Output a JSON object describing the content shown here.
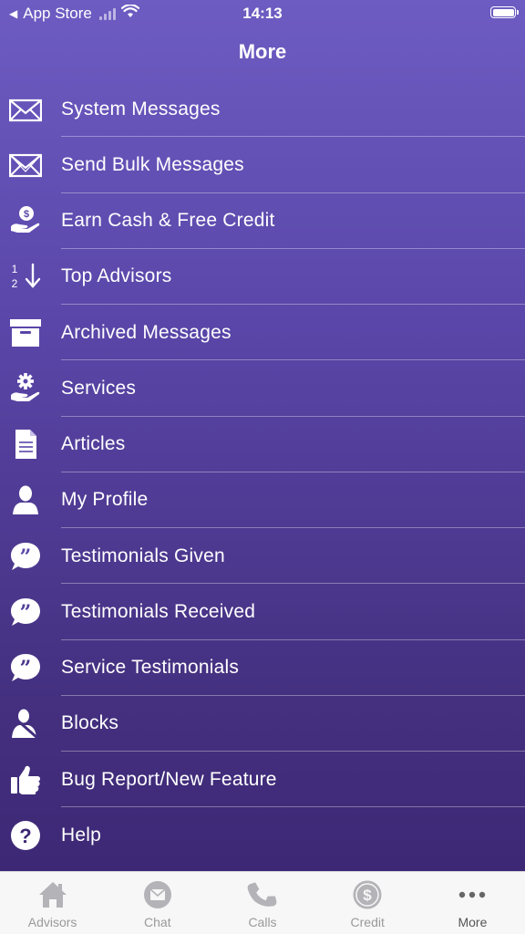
{
  "status_bar": {
    "back_label": "App Store",
    "time": "14:13"
  },
  "nav": {
    "title": "More"
  },
  "menu": {
    "items": [
      {
        "label": "System Messages",
        "icon": "envelope-icon"
      },
      {
        "label": "Send Bulk Messages",
        "icon": "bulk-envelope-icon"
      },
      {
        "label": "Earn Cash & Free Credit",
        "icon": "hand-money-icon"
      },
      {
        "label": "Top Advisors",
        "icon": "sort-numeric-icon"
      },
      {
        "label": "Archived Messages",
        "icon": "archive-box-icon"
      },
      {
        "label": "Services",
        "icon": "hand-gear-icon"
      },
      {
        "label": "Articles",
        "icon": "document-icon"
      },
      {
        "label": "My Profile",
        "icon": "person-icon"
      },
      {
        "label": "Testimonials Given",
        "icon": "quote-bubble-icon"
      },
      {
        "label": "Testimonials Received",
        "icon": "quote-bubble-icon"
      },
      {
        "label": "Service Testimonials",
        "icon": "quote-bubble-icon"
      },
      {
        "label": "Blocks",
        "icon": "blocked-user-icon"
      },
      {
        "label": "Bug Report/New Feature",
        "icon": "thumbs-up-icon"
      },
      {
        "label": "Help",
        "icon": "question-circle-icon"
      }
    ]
  },
  "tab_bar": {
    "tabs": [
      {
        "label": "Advisors",
        "icon": "home-icon"
      },
      {
        "label": "Chat",
        "icon": "chat-envelope-icon"
      },
      {
        "label": "Calls",
        "icon": "phone-icon"
      },
      {
        "label": "Credit",
        "icon": "dollar-coin-icon"
      },
      {
        "label": "More",
        "icon": "more-dots-icon"
      }
    ],
    "active": "More"
  },
  "colors": {
    "gradient_top": "#6d5cc2",
    "gradient_bottom": "#3a2572",
    "tab_inactive": "#9a9a9a",
    "tab_active": "#555555"
  }
}
